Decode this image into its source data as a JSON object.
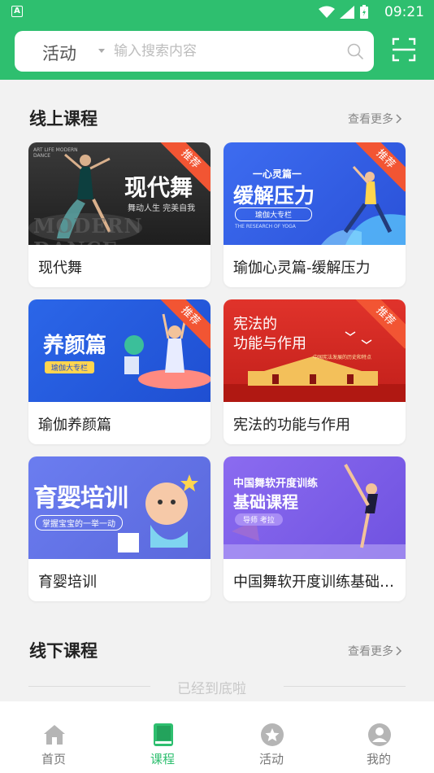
{
  "status_bar": {
    "time": "09:21",
    "notification_letter": "A"
  },
  "search": {
    "category": "活动",
    "placeholder": "输入搜索内容"
  },
  "online": {
    "title": "线上课程",
    "see_more": "查看更多",
    "courses": [
      {
        "name": "现代舞",
        "badge": "推荐",
        "thumb_title": "现代舞",
        "thumb_subtitle": "舞动人生 完美自我",
        "thumb_bg_text": "MODERN DANCE",
        "thumb_corner_text": "ART LIFE MODERN DANCE"
      },
      {
        "name": "瑜伽心灵篇-缓解压力",
        "badge": "推荐",
        "thumb_kicker": "一心灵篇一",
        "thumb_title": "缓解压力",
        "thumb_tag": "瑜伽大专栏",
        "thumb_small": "THE RESEARCH OF YOGA"
      },
      {
        "name": "瑜伽养颜篇",
        "badge": "推荐",
        "thumb_title": "养颜篇",
        "thumb_tag": "瑜伽大专栏"
      },
      {
        "name": "宪法的功能与作用",
        "badge": "推荐",
        "thumb_title_1": "宪法的",
        "thumb_title_2": "功能与作用",
        "thumb_sub": "中国宪法发展的历史和特点"
      },
      {
        "name": "育婴培训",
        "badge": "",
        "thumb_title": "育婴培训",
        "thumb_sub": "掌握宝宝的一举一动"
      },
      {
        "name": "中国舞软开度训练基础课程",
        "badge": "",
        "thumb_title_1": "中国舞软开度训练",
        "thumb_title_2": "基础课程",
        "thumb_tag": "导师 考拉"
      }
    ]
  },
  "offline": {
    "title": "线下课程",
    "see_more": "查看更多"
  },
  "end_text": "已经到底啦",
  "tabbar": {
    "items": [
      {
        "label": "首页",
        "icon": "home-icon"
      },
      {
        "label": "课程",
        "icon": "book-icon"
      },
      {
        "label": "活动",
        "icon": "star-icon"
      },
      {
        "label": "我的",
        "icon": "user-icon"
      }
    ],
    "active_index": 1
  },
  "colors": {
    "brand": "#2ebf6f",
    "badge": "#f25533",
    "inactive": "#b5b5b5"
  }
}
